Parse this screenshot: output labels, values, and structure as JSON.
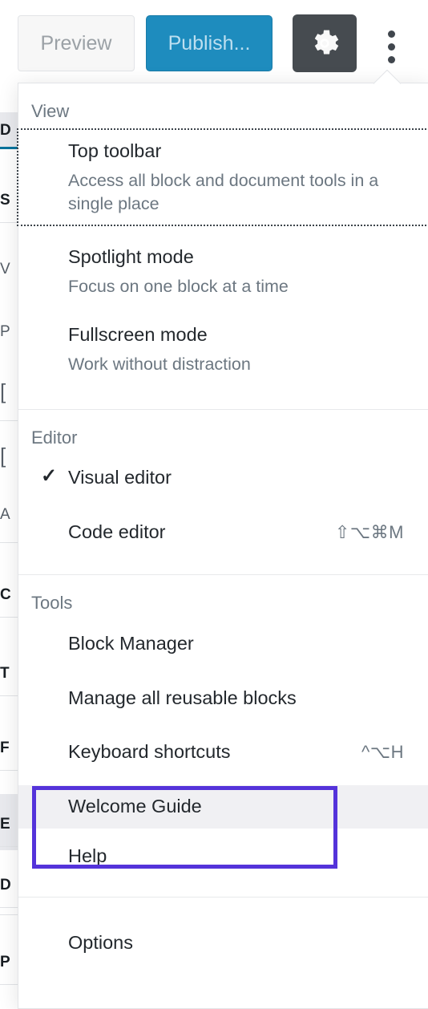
{
  "toolbar": {
    "preview_label": "Preview",
    "publish_label": "Publish...",
    "settings_icon": "gear-icon",
    "more_icon": "ellipsis-vertical-icon"
  },
  "menu": {
    "groups": [
      {
        "id": "view",
        "label": "View",
        "items": [
          {
            "id": "top-toolbar",
            "title": "Top toolbar",
            "description": "Access all block and document tools in a single place",
            "shortcut": "",
            "checked": false,
            "focused": true,
            "hovered": false
          },
          {
            "id": "spotlight-mode",
            "title": "Spotlight mode",
            "description": "Focus on one block at a time",
            "shortcut": "",
            "checked": false,
            "focused": false,
            "hovered": false
          },
          {
            "id": "fullscreen-mode",
            "title": "Fullscreen mode",
            "description": "Work without distraction",
            "shortcut": "",
            "checked": false,
            "focused": false,
            "hovered": false
          }
        ]
      },
      {
        "id": "editor",
        "label": "Editor",
        "items": [
          {
            "id": "visual-editor",
            "title": "Visual editor",
            "description": "",
            "shortcut": "",
            "checked": true,
            "check_glyph": "✓",
            "focused": false,
            "hovered": false
          },
          {
            "id": "code-editor",
            "title": "Code editor",
            "description": "",
            "shortcut": "⇧⌥⌘M",
            "checked": false,
            "focused": false,
            "hovered": false
          }
        ]
      },
      {
        "id": "tools",
        "label": "Tools",
        "items": [
          {
            "id": "block-manager",
            "title": "Block Manager",
            "description": "",
            "shortcut": "",
            "checked": false,
            "focused": false,
            "hovered": false
          },
          {
            "id": "manage-reusable-blocks",
            "title": "Manage all reusable blocks",
            "description": "",
            "shortcut": "",
            "checked": false,
            "focused": false,
            "hovered": false
          },
          {
            "id": "keyboard-shortcuts",
            "title": "Keyboard shortcuts",
            "description": "",
            "shortcut": "^⌥H",
            "checked": false,
            "focused": false,
            "hovered": false
          },
          {
            "id": "welcome-guide",
            "title": "Welcome Guide",
            "description": "",
            "shortcut": "",
            "checked": false,
            "focused": false,
            "hovered": true
          },
          {
            "id": "help",
            "title": "Help",
            "description": "",
            "shortcut": "",
            "checked": false,
            "focused": false,
            "hovered": false
          }
        ]
      },
      {
        "id": "preferences",
        "label": "",
        "items": [
          {
            "id": "options",
            "title": "Options",
            "description": "",
            "shortcut": "",
            "checked": false,
            "focused": false,
            "hovered": false
          }
        ]
      }
    ]
  },
  "annotation": {
    "target": "welcome-guide",
    "color": "#5433da"
  },
  "background": {
    "occluded_labels": [
      "D",
      "S",
      "V",
      "P",
      "[",
      "[",
      "A",
      "C",
      "T",
      "F",
      "E",
      "D",
      "P"
    ]
  },
  "colors": {
    "publish_blue": "#1e8cbe",
    "settings_dark": "#464b50",
    "highlight_purple": "#5433da",
    "hover_gray": "#f0f0f3",
    "muted_text": "#6c7781",
    "body_text": "#23282d"
  }
}
